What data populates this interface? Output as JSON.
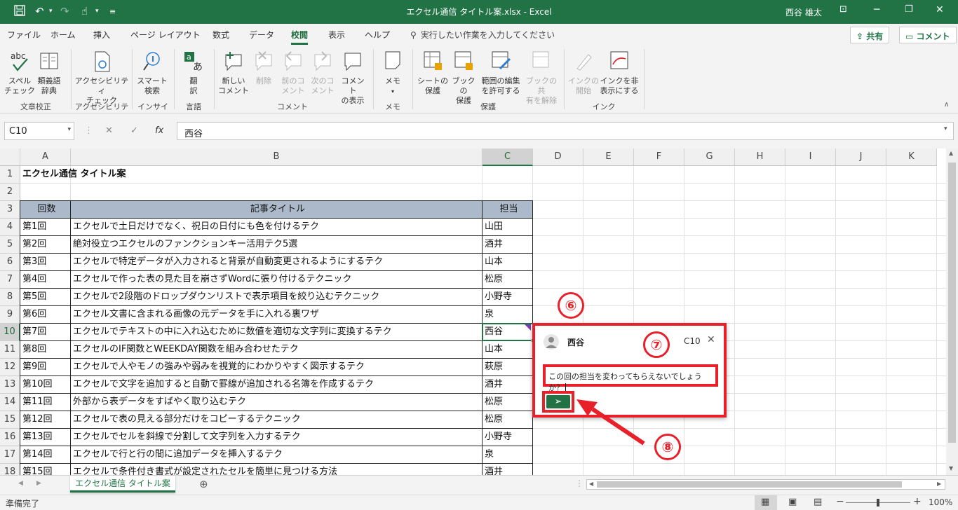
{
  "window": {
    "title": "エクセル通信 タイトル案.xlsx  -  Excel",
    "user": "西谷 雄太"
  },
  "tabs": [
    "ファイル",
    "ホーム",
    "挿入",
    "ページ レイアウト",
    "数式",
    "データ",
    "校閲",
    "表示",
    "ヘルプ"
  ],
  "active_tab": "校閲",
  "tell_me": "実行したい作業を入力してください",
  "share_label": "共有",
  "comment_btn_label": "コメント",
  "ribbon": {
    "btn_spell": "スペル\nチェック",
    "btn_thesaurus": "類義語\n辞典",
    "btn_access": "アクセシビリティ\nチェック",
    "btn_smart": "スマート\n検索",
    "btn_translate": "翻\n訳",
    "btn_new_comment": "新しい\nコメント",
    "btn_delete": "削除",
    "btn_prev": "前のコ\nメント",
    "btn_next": "次のコ\nメント",
    "btn_show": "コメント\nの表示",
    "btn_memo": "メモ",
    "btn_protect_sheet": "シートの\n保護",
    "btn_protect_book": "ブックの\n保護",
    "btn_allow_edit": "範囲の編集\nを許可する",
    "btn_unshare": "ブックの共\n有を解除",
    "btn_start_ink": "インクの\n開始",
    "btn_hide_ink": "インクを非\n表示にする",
    "grp_proofing": "文章校正",
    "grp_access": "アクセシビリティ",
    "grp_insight": "インサイト",
    "grp_language": "言語",
    "grp_comment": "コメント",
    "grp_memo": "メモ",
    "grp_protect": "保護",
    "grp_ink": "インク"
  },
  "formula_bar": {
    "name_box": "C10",
    "formula": "西谷"
  },
  "columns": [
    "A",
    "B",
    "C",
    "D",
    "E",
    "F",
    "G",
    "H",
    "I",
    "J",
    "K"
  ],
  "rows": [
    "1",
    "2",
    "3",
    "4",
    "5",
    "6",
    "7",
    "8",
    "9",
    "10",
    "11",
    "12",
    "13",
    "14",
    "15",
    "16",
    "17",
    "18"
  ],
  "sheet": {
    "title": "エクセル通信 タイトル案",
    "headers": {
      "a": "回数",
      "b": "記事タイトル",
      "c": "担当"
    },
    "data": [
      {
        "a": "第1回",
        "b": "エクセルで土日だけでなく、祝日の日付にも色を付けるテク",
        "c": "山田"
      },
      {
        "a": "第2回",
        "b": "絶対役立つエクセルのファンクションキー活用テク5選",
        "c": "酒井"
      },
      {
        "a": "第3回",
        "b": "エクセルで特定データが入力されると背景が自動変更されるようにするテク",
        "c": "山本"
      },
      {
        "a": "第4回",
        "b": "エクセルで作った表の見た目を崩さずWordに張り付けるテクニック",
        "c": "松原"
      },
      {
        "a": "第5回",
        "b": "エクセルで2段階のドロップダウンリストで表示項目を絞り込むテクニック",
        "c": "小野寺"
      },
      {
        "a": "第6回",
        "b": "エクセル文書に含まれる画像の元データを手に入れる裏ワザ",
        "c": "泉"
      },
      {
        "a": "第7回",
        "b": "エクセルでテキストの中に入れ込むために数値を適切な文字列に変換するテク",
        "c": "西谷"
      },
      {
        "a": "第8回",
        "b": "エクセルのIF関数とWEEKDAY関数を組み合わせたテク",
        "c": "山本"
      },
      {
        "a": "第9回",
        "b": "エクセルで人やモノの強みや弱みを視覚的にわかりやすく図示するテク",
        "c": "萩原"
      },
      {
        "a": "第10回",
        "b": "エクセルで文字を追加すると自動で罫線が追加される名簿を作成するテク",
        "c": "酒井"
      },
      {
        "a": "第11回",
        "b": "外部から表データをすばやく取り込むテク",
        "c": "松原"
      },
      {
        "a": "第12回",
        "b": "エクセルで表の見える部分だけをコピーするテクニック",
        "c": "松原"
      },
      {
        "a": "第13回",
        "b": "エクセルでセルを斜線で分割して文字列を入力するテク",
        "c": "小野寺"
      },
      {
        "a": "第14回",
        "b": "エクセルで行と行の間に追加データを挿入するテク",
        "c": "泉"
      },
      {
        "a": "第15回",
        "b": "エクセルで条件付き書式が設定されたセルを簡単に見つける方法",
        "c": "酒井"
      }
    ]
  },
  "comment_card": {
    "author": "西谷",
    "cell_ref": "C10",
    "input_text": "この回の担当を変わってもらえないでしょうか？",
    "send_glyph": "➢"
  },
  "callouts": {
    "c6": "⑥",
    "c7": "⑦",
    "c8": "⑧"
  },
  "sheet_tab": "エクセル通信 タイトル案",
  "status": {
    "ready": "準備完了",
    "zoom": "100%"
  },
  "colors": {
    "accent": "#217346",
    "callout": "#e8202a",
    "header_fill": "#acb9ca"
  }
}
